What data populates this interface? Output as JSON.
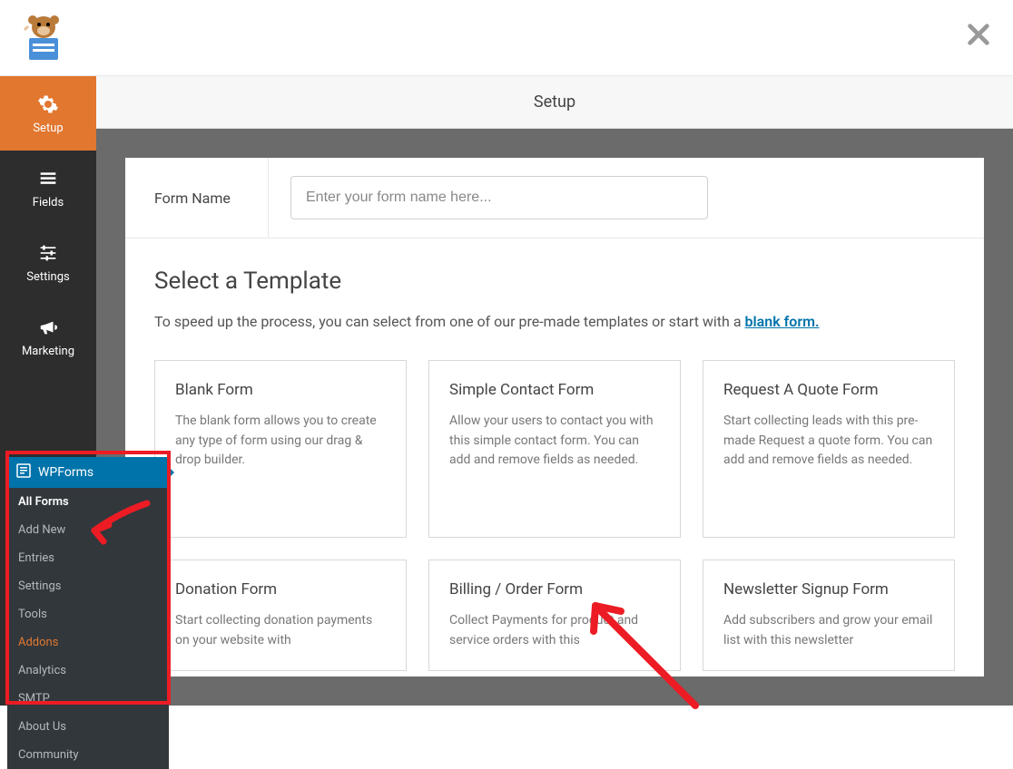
{
  "header": {
    "title": "Setup"
  },
  "form_name": {
    "label": "Form Name",
    "placeholder": "Enter your form name here..."
  },
  "template_section": {
    "title": "Select a Template",
    "desc_prefix": "To speed up the process, you can select from one of our pre-made templates or start with a ",
    "blank_link": "blank form."
  },
  "templates": [
    {
      "title": "Blank Form",
      "desc": "The blank form allows you to create any type of form using our drag & drop builder."
    },
    {
      "title": "Simple Contact Form",
      "desc": "Allow your users to contact you with this simple contact form. You can add and remove fields as needed."
    },
    {
      "title": "Request A Quote Form",
      "desc": "Start collecting leads with this pre-made Request a quote form. You can add and remove fields as needed."
    },
    {
      "title": "Donation Form",
      "desc": "Start collecting donation payments on your website with"
    },
    {
      "title": "Billing / Order Form",
      "desc": "Collect Payments for product and service orders with this"
    },
    {
      "title": "Newsletter Signup Form",
      "desc": "Add subscribers and grow your email list with this newsletter"
    }
  ],
  "sidebar": {
    "items": [
      {
        "label": "Setup",
        "icon": "gear"
      },
      {
        "label": "Fields",
        "icon": "list"
      },
      {
        "label": "Settings",
        "icon": "sliders"
      },
      {
        "label": "Marketing",
        "icon": "bullhorn"
      }
    ]
  },
  "wp_submenu": {
    "head": "WPForms",
    "items": [
      {
        "label": "All Forms",
        "active": true
      },
      {
        "label": "Add New"
      },
      {
        "label": "Entries"
      },
      {
        "label": "Settings"
      },
      {
        "label": "Tools"
      },
      {
        "label": "Addons",
        "addons": true
      },
      {
        "label": "Analytics"
      },
      {
        "label": "SMTP"
      },
      {
        "label": "About Us"
      },
      {
        "label": "Community"
      }
    ]
  }
}
